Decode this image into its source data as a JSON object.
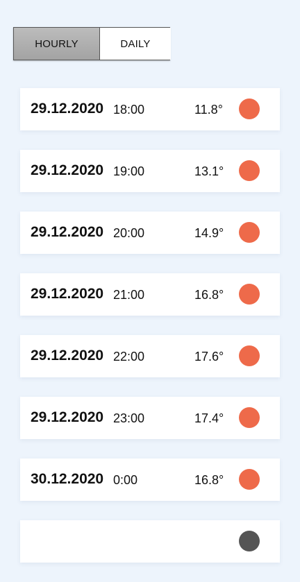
{
  "tabs": {
    "hourly_label": "HOURLY",
    "daily_label": "DAILY",
    "selected": "HOURLY"
  },
  "colors": {
    "accent_dot": "#ee6a4a",
    "dark_dot": "#555555",
    "selected_tab": "#a8a8a8",
    "background": "#edf4fc"
  },
  "forecast": [
    {
      "date": "29.12.2020",
      "time": "18:00",
      "temp": "11.8°",
      "icon": "sun-dot-icon"
    },
    {
      "date": "29.12.2020",
      "time": "19:00",
      "temp": "13.1°",
      "icon": "sun-dot-icon"
    },
    {
      "date": "29.12.2020",
      "time": "20:00",
      "temp": "14.9°",
      "icon": "sun-dot-icon"
    },
    {
      "date": "29.12.2020",
      "time": "21:00",
      "temp": "16.8°",
      "icon": "sun-dot-icon"
    },
    {
      "date": "29.12.2020",
      "time": "22:00",
      "temp": "17.6°",
      "icon": "sun-dot-icon"
    },
    {
      "date": "29.12.2020",
      "time": "23:00",
      "temp": "17.4°",
      "icon": "sun-dot-icon"
    },
    {
      "date": "30.12.2020",
      "time": "0:00",
      "temp": "16.8°",
      "icon": "sun-dot-icon"
    },
    {
      "date": "",
      "time": "",
      "temp": "",
      "icon": "moon-dot-icon"
    }
  ]
}
